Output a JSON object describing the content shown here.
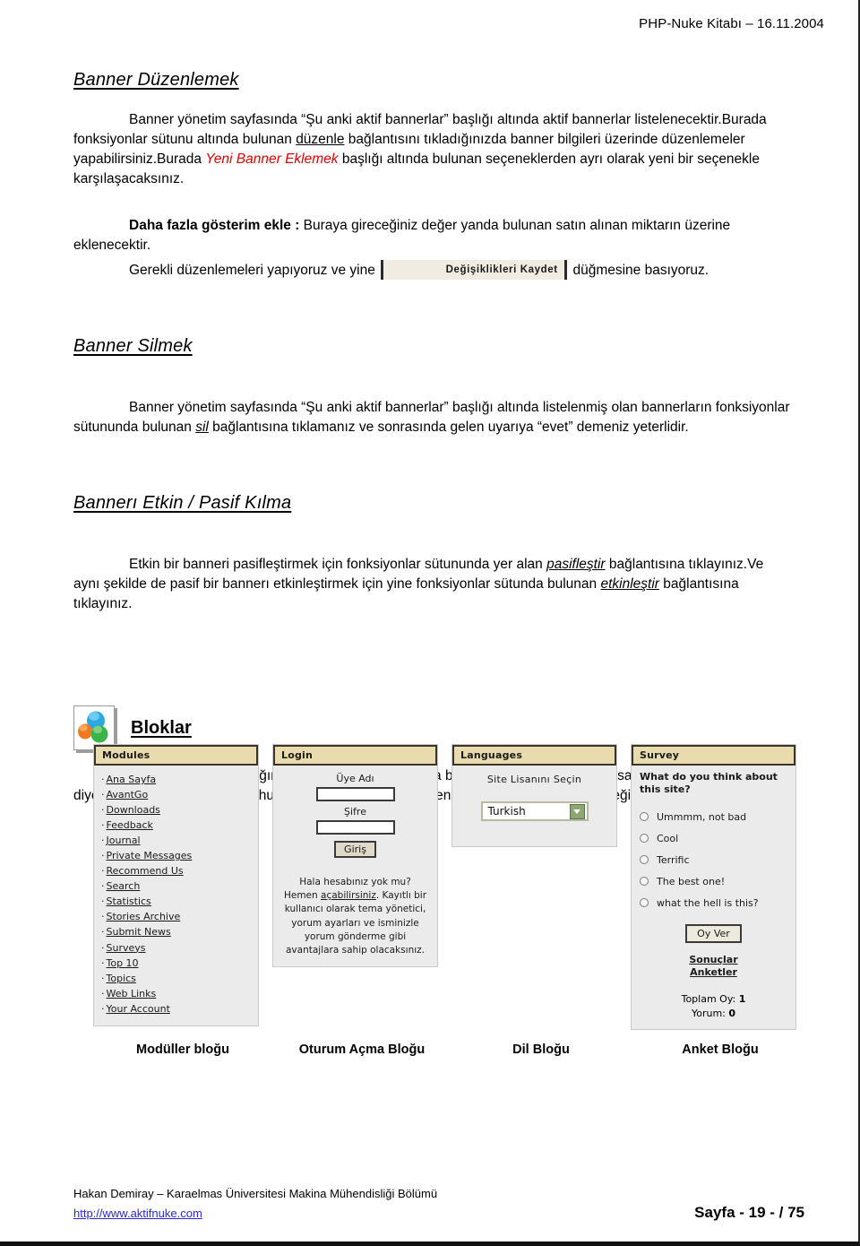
{
  "header": {
    "title": "PHP-Nuke Kitabı – 16.11.2004"
  },
  "sections": {
    "edit": {
      "title": "Banner Düzenlemek",
      "p1_a": "Banner yönetim sayfasında “Şu anki aktif bannerlar” başlığı altında aktif bannerlar listelenecektir.Burada fonksiyonlar sütunu altında bulunan ",
      "p1_link": "düzenle",
      "p1_b": " bağlantısını tıkladığınızda banner bilgileri üzerinde düzenlemeler yapabilirsiniz.Burada ",
      "p1_red": "Yeni Banner Eklemek",
      "p1_c": " başlığı altında bulunan seçeneklerden ayrı olarak yeni bir seçenekle karşılaşacaksınız.",
      "p2_bold": "Daha fazla gösterim ekle :",
      "p2_text": " Buraya gireceğiniz değer yanda bulunan satın alınan miktarın üzerine eklenecektir.",
      "p3_a": "Gerekli düzenlemeleri yapıyoruz ve yine",
      "p3_button": "Değişiklikleri Kaydet",
      "p3_b": "düğmesine basıyoruz."
    },
    "delete": {
      "title": "Banner Silmek",
      "p1_a": "Banner yönetim sayfasında “Şu anki aktif bannerlar” başlığı altında listelenmiş olan bannerların fonksiyonlar sütununda bulunan ",
      "p1_link": "sil",
      "p1_b": " bağlantısına tıklamanız ve sonrasında gelen uyarıya “evet” demeniz yeterlidir."
    },
    "toggle": {
      "title": "Bannerı Etkin / Pasif Kılma",
      "p1_a": "Etkin bir banneri pasifleştirmek için fonksiyonlar sütununda yer alan ",
      "p1_link1": "pasifleştir",
      "p1_b": " bağlantısına tıklayınız.Ve aynı şekilde de pasif bir bannerı etkinleştirmek için yine fonksiyonlar sütunda bulunan ",
      "p1_link2": "etkinleştir",
      "p1_c": " bağlantısına tıklayınız."
    },
    "blocks": {
      "title": "Bloklar",
      "icon": "blocks-icon",
      "p1": "Bloklar sayfamızın sağında,solunda veya ortasında bulunabilirler.Neredeyse bir sayfa bloklardan oluşur diyebiliriz.Peki sağda,solda yahut ortada! Ama hangisi derseniz de bakın birkaç blok örneği."
    }
  },
  "nuke_blocks": {
    "modules": {
      "title": "Modules",
      "items": [
        "Ana Sayfa",
        "AvantGo",
        "Downloads",
        "Feedback",
        "Journal",
        "Private Messages",
        "Recommend Us",
        "Search",
        "Statistics",
        "Stories Archive",
        "Submit News",
        "Surveys",
        "Top 10",
        "Topics",
        "Web Links",
        "Your Account"
      ]
    },
    "login": {
      "title": "Login",
      "username_label": "Üye Adı",
      "username_value": "",
      "password_label": "Şifre",
      "password_value": "",
      "submit_label": "Giriş",
      "note_a": "Hala hesabınız yok mu? Hemen ",
      "note_link": "açabilirsiniz",
      "note_b": ". Kayıtlı bir kullanıcı olarak tema yönetici, yorum ayarları ve isminizle yorum gönderme gibi avantajlara sahip olacaksınız."
    },
    "languages": {
      "title": "Languages",
      "label": "Site Lisanını Seçin",
      "selected": "Turkish",
      "arrow_icon": "chevron-down-icon"
    },
    "survey": {
      "title": "Survey",
      "question": "What do you think about this site?",
      "options": [
        "Ummmm, not bad",
        "Cool",
        "Terrific",
        "The best one!",
        "what the hell is this?"
      ],
      "vote_button": "Oy Ver",
      "links": [
        "Sonuçlar",
        "Anketler"
      ],
      "total_label": "Toplam Oy:",
      "total_value": "1",
      "comment_label": "Yorum:",
      "comment_value": "0"
    }
  },
  "captions": [
    "Modüller bloğu",
    "Oturum Açma Bloğu",
    "Dil Bloğu",
    "Anket Bloğu"
  ],
  "footer": {
    "author": "Hakan Demiray – Karaelmas Üniversitesi Makina Mühendisliği Bölümü",
    "url": "http://www.aktifnuke.com",
    "page": "Sayfa - 19 - / 75"
  },
  "colors": {
    "accent_red": "#e00000",
    "link_blue": "#2a2ad0",
    "block_header": "#e8dcaf",
    "block_body": "#ebebeb"
  }
}
